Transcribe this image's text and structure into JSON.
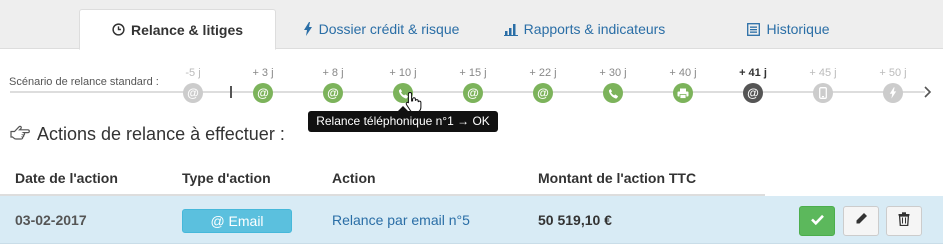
{
  "tabs": [
    {
      "label": "Relance & litiges",
      "icon": "clock-icon",
      "active": true
    },
    {
      "label": "Dossier crédit & risque",
      "icon": "bolt-icon",
      "active": false
    },
    {
      "label": "Rapports & indicateurs",
      "icon": "bar-chart-icon",
      "active": false
    },
    {
      "label": "Historique",
      "icon": "list-icon",
      "active": false
    }
  ],
  "scenario": {
    "label": "Scénario de relance standard :",
    "steps": [
      {
        "label": "-5 j",
        "icon": "at-icon",
        "state": "future"
      },
      {
        "label": "+ 3 j",
        "icon": "at-icon",
        "state": "done"
      },
      {
        "label": "+ 8 j",
        "icon": "at-icon",
        "state": "done"
      },
      {
        "label": "+ 10 j",
        "icon": "phone-icon",
        "state": "done"
      },
      {
        "label": "+ 15 j",
        "icon": "at-icon",
        "state": "done"
      },
      {
        "label": "+ 22 j",
        "icon": "at-icon",
        "state": "done"
      },
      {
        "label": "+ 30 j",
        "icon": "phone-icon",
        "state": "done"
      },
      {
        "label": "+ 40 j",
        "icon": "print-icon",
        "state": "done"
      },
      {
        "label": "+ 41 j",
        "icon": "at-icon",
        "state": "current"
      },
      {
        "label": "+ 45 j",
        "icon": "mobile-icon",
        "state": "future"
      },
      {
        "label": "+ 50 j",
        "icon": "bolt-icon",
        "state": "future"
      }
    ],
    "tooltip": "Relance téléphonique n°1 → OK"
  },
  "section": {
    "title": "Actions de relance à effectuer :",
    "icon": "hand-pointer-icon"
  },
  "table": {
    "headers": [
      "Date de l'action",
      "Type d'action",
      "Action",
      "Montant de l'action TTC"
    ],
    "rows": [
      {
        "date": "03-02-2017",
        "type": "@ Email",
        "action": "Relance par email n°5",
        "amount": "50 519,10 €"
      }
    ]
  },
  "colors": {
    "done": "#7cb35b",
    "current": "#555555",
    "future": "#cccccc",
    "row_highlight": "#d8ebf5",
    "badge": "#5bc0de",
    "ok_button": "#5cb85c",
    "link": "#2a6ea6"
  }
}
